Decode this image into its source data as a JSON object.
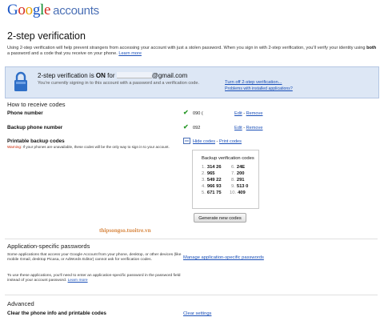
{
  "header": {
    "logo_letters": [
      "G",
      "o",
      "o",
      "g",
      "l",
      "e"
    ],
    "logo_suffix": "accounts"
  },
  "page_title": "2-step verification",
  "intro": {
    "part1": "Using 2-step verification will help prevent strangers from accessing your account with just a stolen password. When you sign in with 2-step verification, you'll verify your identity using ",
    "both": "both",
    "part2": " a password and a code that you receive on your phone. ",
    "learn_more": "Learn more"
  },
  "banner": {
    "status_prefix": "2-step verification is ",
    "status_on": "ON",
    "status_mid": " for ",
    "email_suffix": "@gmail.com",
    "subtitle": "You're currently signing in to this account with a password and a verification code.",
    "turn_off_link": "Turn off 2-step verification...",
    "problems_link": "Problems with installed applications?"
  },
  "receive_codes": {
    "heading": "How to receive codes",
    "phone_number_label": "Phone number",
    "phone_number_value": "090 (",
    "backup_phone_label": "Backup phone number",
    "backup_phone_value": "092",
    "edit_label": "Edit",
    "separator": " - ",
    "remove_label": "Remove",
    "backup_codes_label": "Printable backup codes",
    "warning_red": "Warning",
    "warning_text": ": If your phones are unavailable, these codes will be the only way to sign in to your account.",
    "hide_codes_link": "Hide codes",
    "print_codes_link": "Print codes",
    "box_title": "Backup verification codes",
    "codes": [
      {
        "n": "1.",
        "code": "314 26"
      },
      {
        "n": "2.",
        "code": "965 "
      },
      {
        "n": "3.",
        "code": "549 22"
      },
      {
        "n": "4.",
        "code": "966 93"
      },
      {
        "n": "5.",
        "code": "671 75"
      },
      {
        "n": "6.",
        "code": "24E"
      },
      {
        "n": "7.",
        "code": "200"
      },
      {
        "n": "8.",
        "code": "291"
      },
      {
        "n": "9.",
        "code": "513 0"
      },
      {
        "n": "10.",
        "code": "409"
      }
    ],
    "generate_button": "Generate new codes"
  },
  "watermark": "thipsongso.tuoitre.vn",
  "app_passwords": {
    "heading": "Application-specific passwords",
    "para1": "Some applications that access your Google Account from your phone, desktop, or other devices (like mobile Gmail, desktop Picasa, or AdWords Editor) cannot ask for verification codes.",
    "para2": "To use these applications, you'll need to enter an application-specific password in the password field instead of your account password. ",
    "learn_more": "Learn more",
    "manage_link": "Manage application-specific passwords"
  },
  "advanced": {
    "heading": "Advanced",
    "clear_label": "Clear the phone info and printable codes",
    "clear_link": "Clear settings"
  }
}
